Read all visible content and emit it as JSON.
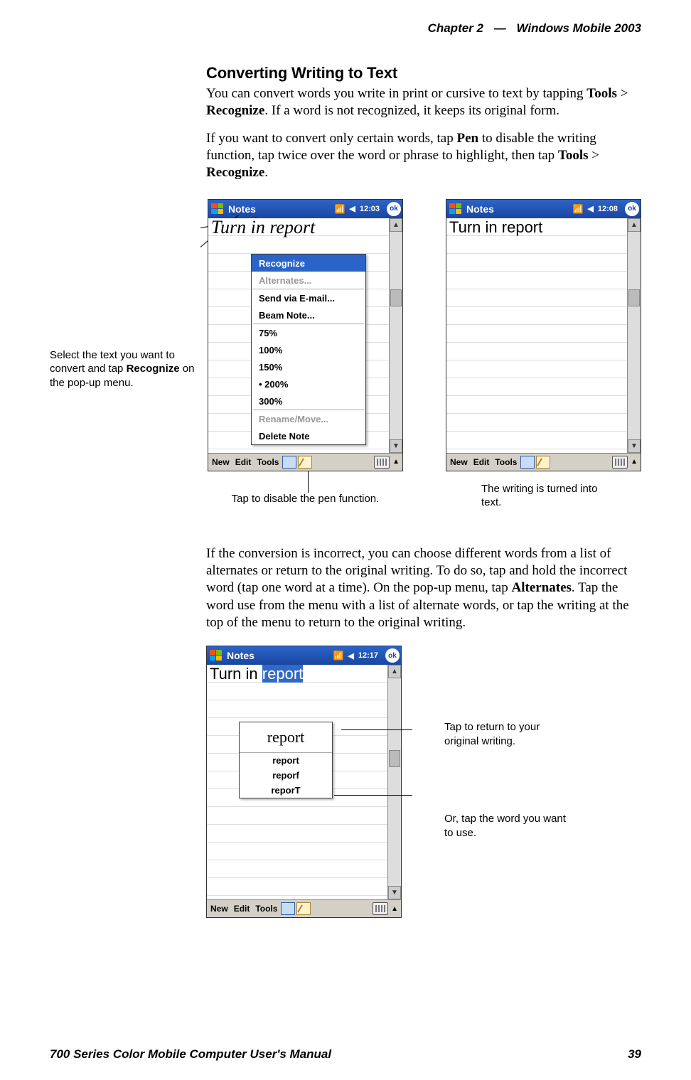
{
  "header": {
    "chapter": "Chapter  2",
    "dash": "—",
    "product": "Windows Mobile 2003"
  },
  "section": {
    "title": "Converting Writing to Text",
    "p1a": "You can convert words you write in print or cursive to text by tapping ",
    "p1b": "Tools",
    "p1c": " > ",
    "p1d": "Recognize",
    "p1e": ". If a word is not recognized, it keeps its original form.",
    "p2a": "If you want to convert only certain words, tap ",
    "p2b": "Pen",
    "p2c": " to disable the writing function, tap twice over the word or phrase to highlight, then tap ",
    "p2d": "Tools",
    "p2e": " > ",
    "p2f": "Recognize",
    "p2g": "."
  },
  "callouts": {
    "left_a": "Select the text you want to convert and tap ",
    "left_bold": "Recognize",
    "left_b": " on the pop-up menu.",
    "under_pen": "Tap to disable the pen function.",
    "right_text": "The writing is turned into text."
  },
  "ppc_left": {
    "app": "Notes",
    "time": "12:03",
    "ok": "ok",
    "handwriting": "Turn in report",
    "menu": {
      "recognize": "Recognize",
      "alternates": "Alternates...",
      "send": "Send via E-mail...",
      "beam": "Beam Note...",
      "z75": "75%",
      "z100": "100%",
      "z150": "150%",
      "z200": "200%",
      "z300": "300%",
      "rename": "Rename/Move...",
      "delete": "Delete Note"
    },
    "toolbar": {
      "new": "New",
      "edit": "Edit",
      "tools": "Tools"
    }
  },
  "ppc_right": {
    "app": "Notes",
    "time": "12:08",
    "ok": "ok",
    "text": "Turn in report",
    "toolbar": {
      "new": "New",
      "edit": "Edit",
      "tools": "Tools"
    }
  },
  "body2": {
    "p3a": "If the conversion is incorrect, you can choose different words from a list of alternates or return to the original writing. To do so, tap and hold the incorrect word (tap one word at a time). On the pop-up menu, tap ",
    "p3b": "Alternates",
    "p3c": ". Tap the word use from the menu with a list of alternate words, or tap the writing at the top of the menu to return to the original writing."
  },
  "ppc_alt": {
    "app": "Notes",
    "time": "12:17",
    "ok": "ok",
    "text_pre": "Turn in ",
    "text_sel": "report",
    "alt_handwriting": "report",
    "alts": [
      "report",
      "reporf",
      "reporT"
    ],
    "toolbar": {
      "new": "New",
      "edit": "Edit",
      "tools": "Tools"
    }
  },
  "lower_callouts": {
    "a": "Tap to return to your original writing.",
    "b": "Or, tap the word you want to use."
  },
  "footer": {
    "left": "700 Series Color Mobile Computer User's Manual",
    "right": "39"
  }
}
